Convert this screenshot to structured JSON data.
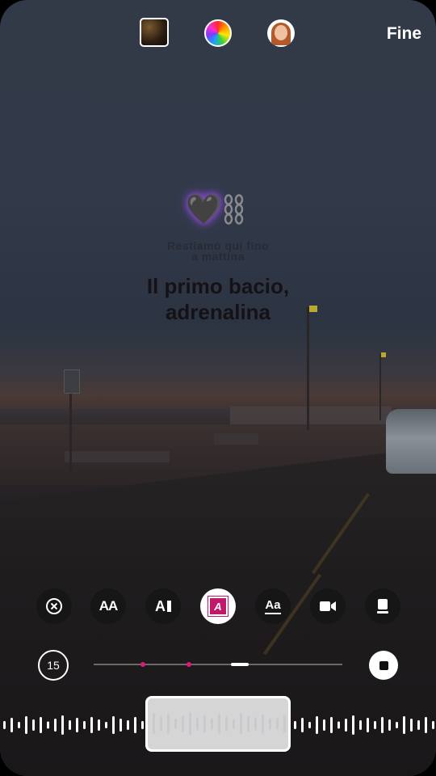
{
  "header": {
    "done_label": "Fine",
    "icons": [
      "photo-thumbnail",
      "color-wheel",
      "profile-avatar"
    ]
  },
  "sticker": {
    "emoji": "🖤",
    "icon": "chains-icon"
  },
  "lyrics": {
    "previous_line_1": "Restiamo qui fino",
    "previous_line_2": "a mattina",
    "current_line_1": "Il primo bacio,",
    "current_line_2": "adrenalina"
  },
  "toolbar": {
    "tools": [
      {
        "name": "remove",
        "icon": "close-circle-icon"
      },
      {
        "name": "text-size",
        "label": "AA"
      },
      {
        "name": "text-cursor",
        "label": "A"
      },
      {
        "name": "highlight-style",
        "label": "A",
        "active": true,
        "accent": "#c2186b"
      },
      {
        "name": "underline-style",
        "label": "Aa"
      },
      {
        "name": "video",
        "icon": "video-camera-icon"
      },
      {
        "name": "layout",
        "icon": "layout-card-icon"
      }
    ]
  },
  "playback": {
    "duration": "15",
    "progress_fraction": 0.58
  },
  "colors": {
    "accent": "#e0187a"
  }
}
